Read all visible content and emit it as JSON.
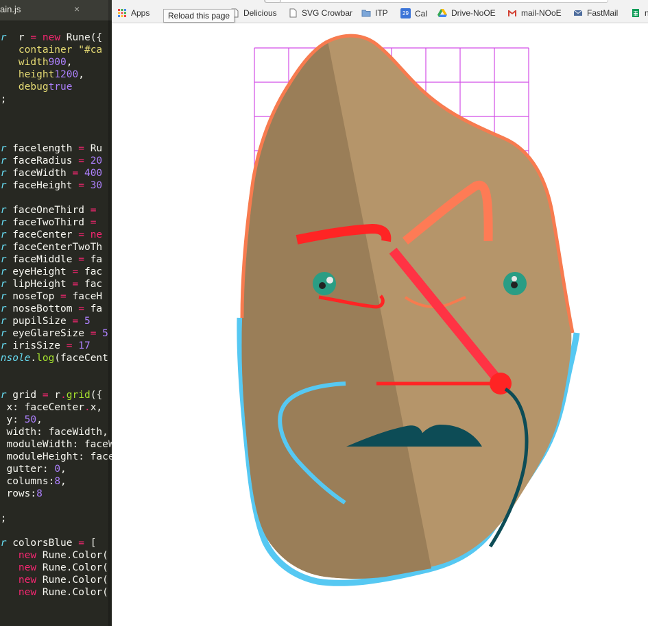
{
  "editor": {
    "tab_title": "ain.js",
    "close_glyph": "×",
    "lines": [
      [
        [
          "kw",
          "ar"
        ],
        [
          "",
          "  r "
        ],
        [
          "op",
          "="
        ],
        [
          "",
          ""
        ],
        [
          "op",
          " new"
        ],
        [
          "",
          " Rune({"
        ]
      ],
      [
        [
          "",
          "    "
        ],
        [
          "prop",
          "container"
        ],
        [
          "",
          " "
        ],
        [
          "str",
          "\"#ca"
        ]
      ],
      [
        [
          "",
          "    "
        ],
        [
          "prop",
          "width"
        ],
        [
          ": "
        ],
        [
          "num",
          "900"
        ],
        [
          "",
          ","
        ]
      ],
      [
        [
          "",
          "    "
        ],
        [
          "prop",
          "height"
        ],
        [
          ": "
        ],
        [
          "num",
          "1200"
        ],
        [
          "",
          ","
        ]
      ],
      [
        [
          "",
          "    "
        ],
        [
          "prop",
          "debug"
        ],
        [
          ": "
        ],
        [
          "num",
          "true"
        ]
      ],
      [
        [
          "",
          ");"
        ]
      ],
      [
        [
          "",
          ""
        ]
      ],
      [
        [
          "",
          ""
        ]
      ],
      [
        [
          "",
          ""
        ]
      ],
      [
        [
          "kw",
          "ar"
        ],
        [
          "",
          " facelength "
        ],
        [
          "op",
          "="
        ],
        [
          "",
          " Ru"
        ]
      ],
      [
        [
          "kw",
          "ar"
        ],
        [
          "",
          " faceRadius "
        ],
        [
          "op",
          "="
        ],
        [
          "num",
          " 20"
        ]
      ],
      [
        [
          "kw",
          "ar"
        ],
        [
          "",
          " faceWidth "
        ],
        [
          "op",
          "="
        ],
        [
          "num",
          " 400"
        ]
      ],
      [
        [
          "kw",
          "ar"
        ],
        [
          "",
          " faceHeight "
        ],
        [
          "op",
          "="
        ],
        [
          "num",
          " 30"
        ]
      ],
      [
        [
          "",
          ""
        ]
      ],
      [
        [
          "kw",
          "ar"
        ],
        [
          "",
          " faceOneThird "
        ],
        [
          "op",
          "="
        ]
      ],
      [
        [
          "kw",
          "ar"
        ],
        [
          "",
          " faceTwoThird "
        ],
        [
          "op",
          "="
        ]
      ],
      [
        [
          "kw",
          "ar"
        ],
        [
          "",
          " faceCenter "
        ],
        [
          "op",
          "="
        ],
        [
          "op",
          " ne"
        ]
      ],
      [
        [
          "kw",
          "ar"
        ],
        [
          "",
          " faceCenterTwoTh"
        ]
      ],
      [
        [
          "kw",
          "ar"
        ],
        [
          "",
          " faceMiddle "
        ],
        [
          "op",
          "="
        ],
        [
          "",
          " fa"
        ]
      ],
      [
        [
          "kw",
          "ar"
        ],
        [
          "",
          " eyeHeight "
        ],
        [
          "op",
          "="
        ],
        [
          "",
          " fac"
        ]
      ],
      [
        [
          "kw",
          "ar"
        ],
        [
          "",
          " lipHeight "
        ],
        [
          "op",
          "="
        ],
        [
          "",
          " fac"
        ]
      ],
      [
        [
          "kw",
          "ar"
        ],
        [
          "",
          " noseTop "
        ],
        [
          "op",
          "="
        ],
        [
          "",
          " faceH"
        ]
      ],
      [
        [
          "kw",
          "ar"
        ],
        [
          "",
          " noseBottom "
        ],
        [
          "op",
          "="
        ],
        [
          "",
          " fa"
        ]
      ],
      [
        [
          "kw",
          "ar"
        ],
        [
          "",
          " pupilSize "
        ],
        [
          "op",
          "="
        ],
        [
          "num",
          " 5"
        ]
      ],
      [
        [
          "kw",
          "ar"
        ],
        [
          "",
          " eyeGlareSize "
        ],
        [
          "op",
          "="
        ],
        [
          "num",
          " 5"
        ]
      ],
      [
        [
          "kw",
          "ar"
        ],
        [
          "",
          " irisSize "
        ],
        [
          "op",
          "="
        ],
        [
          "num",
          " 17"
        ]
      ],
      [
        [
          "kw",
          "onsole"
        ],
        [
          "",
          "."
        ],
        [
          "fn",
          "log"
        ],
        [
          "",
          "(faceCent"
        ]
      ],
      [
        [
          "",
          ""
        ]
      ],
      [
        [
          "",
          ""
        ]
      ],
      [
        [
          "kw",
          "ar"
        ],
        [
          "",
          " grid "
        ],
        [
          "op",
          "="
        ],
        [
          "",
          " r"
        ],
        [
          "op",
          "."
        ],
        [
          "fn",
          "grid"
        ],
        [
          "",
          "({"
        ]
      ],
      [
        [
          "",
          "  x: faceCenter"
        ],
        [
          "op",
          "."
        ],
        [
          "",
          "x,"
        ]
      ],
      [
        [
          "",
          "  y: "
        ],
        [
          "num",
          "50"
        ],
        [
          "",
          ","
        ]
      ],
      [
        [
          "",
          "  width: faceWidth,"
        ]
      ],
      [
        [
          "",
          "  moduleWidth: faceW"
        ]
      ],
      [
        [
          "",
          "  moduleHeight: face"
        ]
      ],
      [
        [
          "",
          "  gutter: "
        ],
        [
          "num",
          "0"
        ],
        [
          "",
          ","
        ]
      ],
      [
        [
          "",
          "  columns:"
        ],
        [
          "num",
          "8"
        ],
        [
          "",
          ","
        ]
      ],
      [
        [
          "",
          "  rows:"
        ],
        [
          "num",
          "8"
        ]
      ],
      [
        [
          "",
          ""
        ]
      ],
      [
        [
          "",
          ");"
        ]
      ],
      [
        [
          "",
          ""
        ]
      ],
      [
        [
          "kw",
          "ar"
        ],
        [
          "",
          " colorsBlue "
        ],
        [
          "op",
          "="
        ],
        [
          "",
          " ["
        ]
      ],
      [
        [
          "",
          "    "
        ],
        [
          "op",
          "new"
        ],
        [
          "",
          " Rune.Color("
        ]
      ],
      [
        [
          "",
          "    "
        ],
        [
          "op",
          "new"
        ],
        [
          "",
          " Rune.Color("
        ]
      ],
      [
        [
          "",
          "    "
        ],
        [
          "op",
          "new"
        ],
        [
          "",
          " Rune.Color("
        ]
      ],
      [
        [
          "",
          "    "
        ],
        [
          "op",
          "new"
        ],
        [
          "",
          " Rune.Color("
        ]
      ]
    ]
  },
  "browser": {
    "tooltip": "Reload this page",
    "bookmarks": [
      {
        "label": "Apps",
        "icon": "apps-grid-icon"
      },
      {
        "label": "Delicious",
        "icon": "page-icon"
      },
      {
        "label": "SVG Crowbar",
        "icon": "page-icon"
      },
      {
        "label": "ITP",
        "icon": "folder-icon"
      },
      {
        "label": "Cal",
        "icon": "calendar-icon"
      },
      {
        "label": "Drive-NoOE",
        "icon": "google-drive-icon"
      },
      {
        "label": "mail-NOoE",
        "icon": "gmail-icon"
      },
      {
        "label": "FastMail",
        "icon": "envelope-icon"
      },
      {
        "label": "n",
        "icon": "sheets-icon"
      }
    ],
    "calendar_badge": "29"
  },
  "drawing": {
    "colors": {
      "face_fill": "#b5956a",
      "face_shadow": "#9a7e58",
      "face_outline": "#f77b4f",
      "outline_blue": "#56c8f2",
      "grid": "#d24de6",
      "brow_red": "#ff2424",
      "brow_salmon": "#fe7b55",
      "nose": "#ff3344",
      "eye_green": "#2a9d84",
      "pupil": "#222222",
      "mustache": "#0d4c56"
    }
  }
}
